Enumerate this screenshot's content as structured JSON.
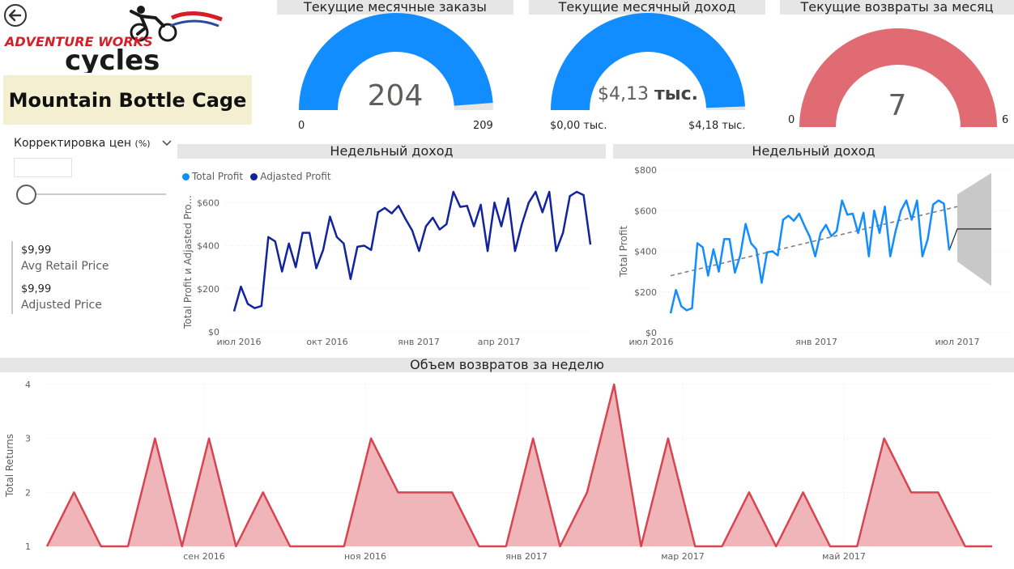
{
  "header": {
    "logo_text_top": "ADVENTURE WORKS",
    "logo_text_bottom": "cycles",
    "product_title": "Mountain Bottle Cage"
  },
  "slicer": {
    "label": "Корректировка цен",
    "unit": "(%)",
    "value": 0
  },
  "kpis": [
    {
      "value": "$9,99",
      "label": "Avg Retail Price"
    },
    {
      "value": "$9,99",
      "label": "Adjusted Price"
    }
  ],
  "gauges": [
    {
      "title": "Текущие месячные заказы",
      "value_text": "204",
      "value": 204,
      "min_text": "0",
      "min": 0,
      "max_text": "209",
      "max": 209,
      "color": "#118dff"
    },
    {
      "title": "Текущие месячный доход",
      "value_text": "$4,13",
      "value_unit": "тыс.",
      "value": 4.13,
      "min_text": "$0,00 тыс.",
      "min": 0,
      "max_text": "$4,18 тыс.",
      "max": 4.18,
      "color": "#118dff"
    },
    {
      "title": "Текущие возвраты за месяц",
      "value_text": "7",
      "value": 7,
      "min_text": "0",
      "min": 0,
      "max_text": "6",
      "max": 6,
      "color": "#e06b73"
    }
  ],
  "chart_data": [
    {
      "type": "line",
      "title": "Недельный доход",
      "ylabel": "Total Profit и Adjasted Pro...",
      "xlabel": "",
      "legend": "top-left",
      "x_ticks": [
        "июл 2016",
        "окт 2016",
        "янв 2017",
        "апр 2017"
      ],
      "y_ticks": [
        "$0",
        "$200",
        "$400",
        "$600"
      ],
      "ylim": [
        0,
        650
      ],
      "series": [
        {
          "name": "Total Profit",
          "color": "#118dff",
          "values": []
        },
        {
          "name": "Adjasted Profit",
          "color": "#12239e",
          "values": [
            95,
            210,
            130,
            110,
            120,
            440,
            420,
            280,
            410,
            300,
            460,
            460,
            295,
            380,
            535,
            440,
            410,
            245,
            395,
            400,
            380,
            555,
            575,
            550,
            585,
            525,
            470,
            375,
            490,
            530,
            475,
            500,
            650,
            580,
            585,
            490,
            590,
            375,
            600,
            490,
            620,
            375,
            500,
            600,
            650,
            555,
            650,
            375,
            460,
            630,
            650,
            635,
            405
          ]
        }
      ]
    },
    {
      "type": "line",
      "title": "Недельный доход",
      "ylabel": "Total Profit",
      "xlabel": "",
      "x_ticks": [
        "июл 2016",
        "янв 2017",
        "июл 2017"
      ],
      "y_ticks": [
        "$0",
        "$200",
        "$400",
        "$600",
        "$800"
      ],
      "ylim": [
        0,
        800
      ],
      "series": [
        {
          "name": "Total Profit",
          "color": "#118dff",
          "values": [
            95,
            210,
            130,
            110,
            120,
            440,
            420,
            280,
            410,
            300,
            460,
            460,
            295,
            380,
            535,
            440,
            410,
            245,
            395,
            400,
            380,
            555,
            575,
            550,
            585,
            525,
            470,
            375,
            490,
            530,
            475,
            500,
            650,
            580,
            585,
            490,
            590,
            375,
            600,
            490,
            620,
            375,
            500,
            600,
            650,
            555,
            650,
            375,
            460,
            630,
            650,
            635,
            405
          ]
        }
      ],
      "trend": {
        "start": 280,
        "end": 620,
        "color": "#808080"
      },
      "forecast": {
        "value": 510,
        "upper_start": 680,
        "upper_end": 785,
        "lower_start": 350,
        "lower_end": 230
      }
    },
    {
      "type": "area",
      "title": "Объем возвратов за неделю",
      "ylabel": "Total Returns",
      "xlabel": "",
      "x_ticks": [
        "сен 2016",
        "ноя 2016",
        "янв 2017",
        "мар 2017",
        "май 2017"
      ],
      "y_ticks": [
        "1",
        "2",
        "3",
        "4"
      ],
      "ylim": [
        1,
        4
      ],
      "series": [
        {
          "name": "Total Returns",
          "color": "#d64550",
          "fill": "#efb5b9",
          "values": [
            1,
            2,
            1,
            1,
            3,
            1,
            3,
            1,
            2,
            1,
            1,
            1,
            3,
            2,
            2,
            2,
            1,
            1,
            3,
            1,
            2,
            4,
            1,
            3,
            1,
            1,
            2,
            1,
            2,
            1,
            1,
            3,
            2,
            2,
            1,
            1
          ]
        }
      ]
    }
  ]
}
